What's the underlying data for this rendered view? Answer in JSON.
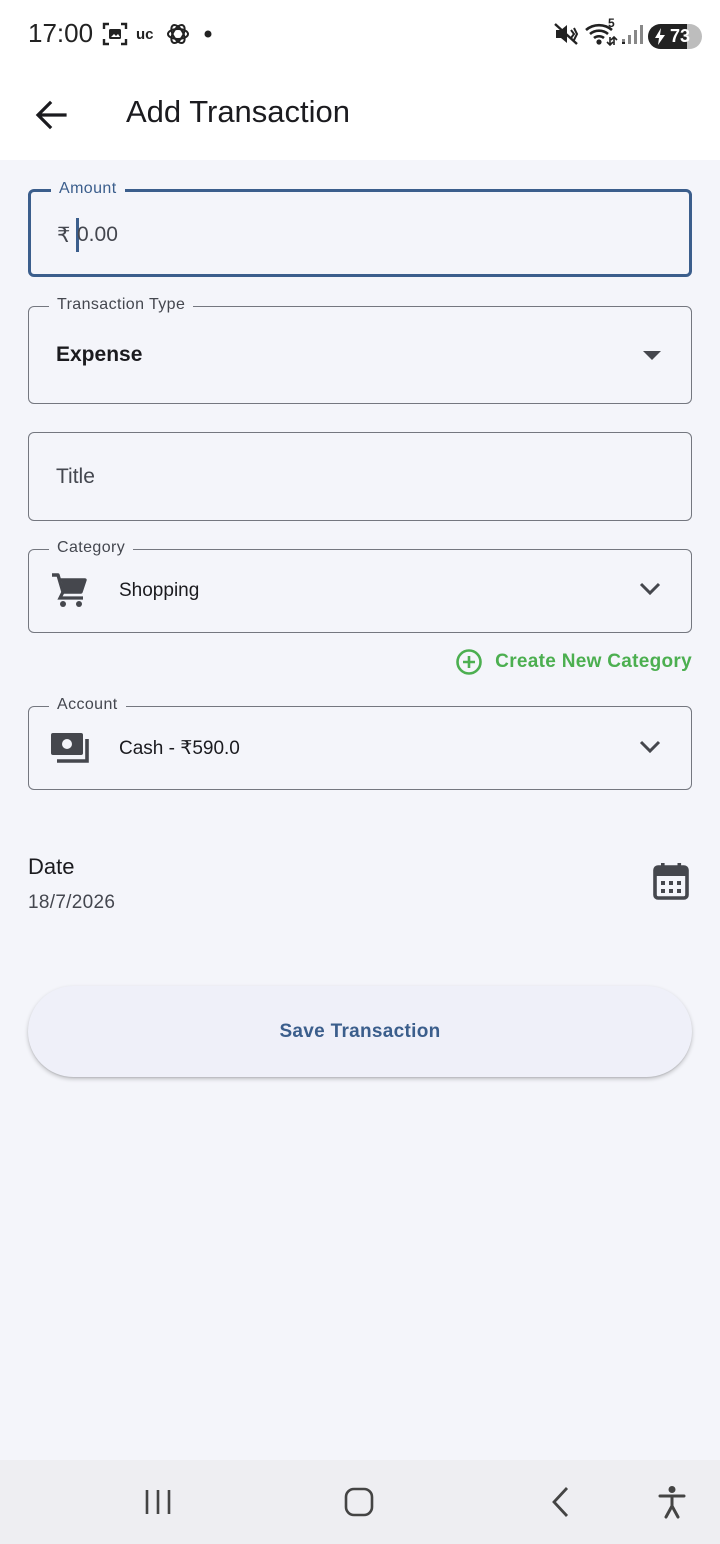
{
  "status_bar": {
    "time": "17:00",
    "carrier_text": "uc",
    "battery_level": "73",
    "network_label": "5",
    "icons": [
      "screenshot-icon",
      "uc-browser-icon",
      "chatgpt-icon",
      "notification-dot-icon",
      "mute-icon",
      "wifi-icon",
      "signal-icon",
      "battery-charging-icon"
    ]
  },
  "app_bar": {
    "title": "Add Transaction",
    "back_icon": "arrow-left-icon"
  },
  "form": {
    "amount": {
      "label": "Amount",
      "prefix": "₹",
      "value": "0.00"
    },
    "transaction_type": {
      "label": "Transaction Type",
      "value": "Expense"
    },
    "title": {
      "placeholder": "Title"
    },
    "category": {
      "label": "Category",
      "value": "Shopping",
      "icon": "shopping-cart-icon"
    },
    "create_category": {
      "label": "Create New Category",
      "icon": "add-circle-icon"
    },
    "account": {
      "label": "Account",
      "value": "Cash - ₹590.0",
      "icon": "payments-icon"
    },
    "date": {
      "label": "Date",
      "value": "18/7/2026",
      "icon": "calendar-icon"
    },
    "save_label": "Save Transaction"
  },
  "colors": {
    "primary": "#3b5e8c",
    "accent_green": "#4caf50",
    "background": "#f4f5fa",
    "outline": "#74777f"
  },
  "nav_bar": {
    "icons": [
      "recent-apps-icon",
      "home-icon",
      "back-icon",
      "accessibility-icon"
    ]
  }
}
